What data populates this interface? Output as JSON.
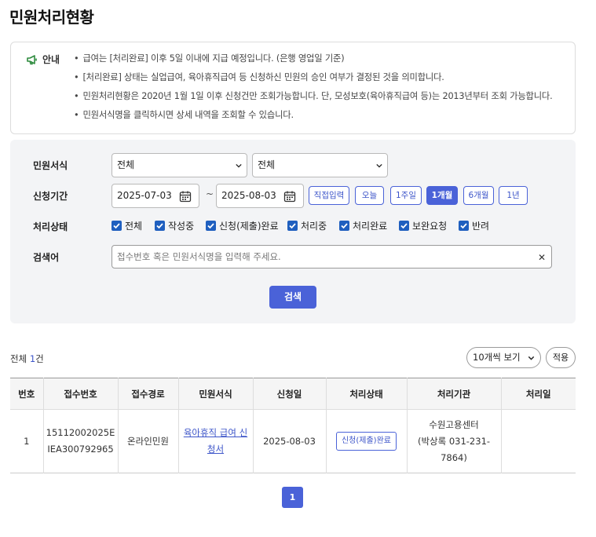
{
  "page": {
    "title": "민원처리현황"
  },
  "notice": {
    "label": "안내",
    "icon": "megaphone-icon",
    "items": [
      "급여는 [처리완료] 이후 5일 이내에 지급 예정입니다. (은행 영업일 기준)",
      "[처리완료] 상태는 실업급여, 육아휴직급여 등 신청하신 민원의 승인 여부가 결정된 것을 의미합니다.",
      "민원처리현황은 2020년 1월 1일 이후 신청건만 조회가능합니다. 단, 모성보호(육아휴직급여 등)는 2013년부터 조회 가능합니다.",
      "민원서식명을 클릭하시면 상세 내역을 조회할 수 있습니다."
    ]
  },
  "filter": {
    "form_label": "민원서식",
    "form_select1": "전체",
    "form_select2": "전체",
    "period_label": "신청기간",
    "date_from": "2025-07-03",
    "date_to": "2025-08-03",
    "tilde": "~",
    "period_buttons": [
      "직접입력",
      "오늘",
      "1주일",
      "1개월",
      "6개월",
      "1년"
    ],
    "period_active": "1개월",
    "status_label": "처리상태",
    "status_options": [
      "전체",
      "작성중",
      "신청(제출)완료",
      "처리중",
      "처리완료",
      "보완요청",
      "반려"
    ],
    "keyword_label": "검색어",
    "keyword_placeholder": "접수번호 혹은 민원서식명을 입력해 주세요.",
    "clear": "✕",
    "search_button": "검색"
  },
  "results": {
    "total_prefix": "전체 ",
    "total_count": "1",
    "total_suffix": "건",
    "per_page": "10개씩 보기",
    "apply": "적용",
    "columns": [
      "번호",
      "접수번호",
      "접수경로",
      "민원서식",
      "신청일",
      "처리상태",
      "처리기관",
      "처리일"
    ],
    "rows": [
      {
        "no": "1",
        "receipt_line1": "15112002025E",
        "receipt_line2": "IEA300792965",
        "channel": "온라인민원",
        "form_line1": "육아휴직 급여 신",
        "form_line2": "청서",
        "date": "2025-08-03",
        "status": "신청(제출)완료",
        "agency_line1": "수원고용센터",
        "agency_line2": "(박상록 031-231-",
        "agency_line3": "7864)",
        "processed": ""
      }
    ]
  },
  "pagination": {
    "current": "1"
  },
  "colors": {
    "accent": "#4a62d8",
    "checkbox": "#1f5fbf"
  }
}
